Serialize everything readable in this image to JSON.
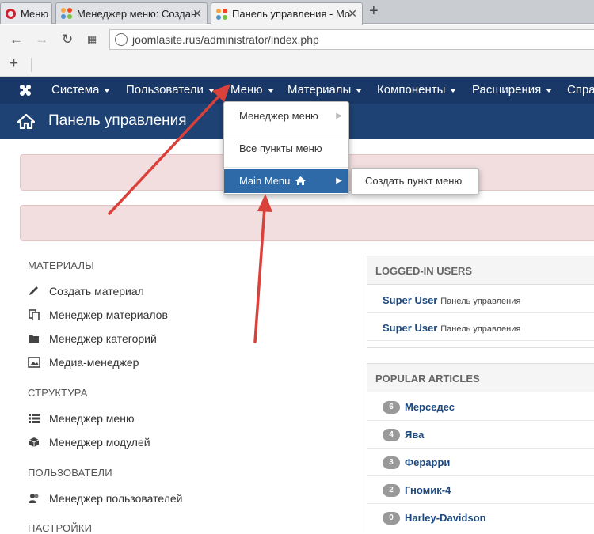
{
  "browser": {
    "tabs": [
      {
        "label": "Меню",
        "type": "opera"
      },
      {
        "label": "Менеджер меню: Создан",
        "type": "joomla"
      },
      {
        "label": "Панель управления - Mo",
        "type": "joomla",
        "active": true
      }
    ],
    "url": "joomlasite.rus/administrator/index.php",
    "new_tab_symbol": "+",
    "bookmark_add_symbol": "+"
  },
  "nav": {
    "items": [
      "Система",
      "Пользователи",
      "Меню",
      "Материалы",
      "Компоненты",
      "Расширения",
      "Спра"
    ]
  },
  "header": {
    "title": "Панель управления"
  },
  "dropdown": {
    "items": [
      "Менеджер меню",
      "Все пункты меню",
      "Main Menu"
    ],
    "submenu_item": "Создать пункт меню"
  },
  "sidebar": {
    "sections": [
      {
        "title": "МАТЕРИАЛЫ",
        "items": [
          "Создать материал",
          "Менеджер материалов",
          "Менеджер категорий",
          "Медиа-менеджер"
        ]
      },
      {
        "title": "СТРУКТУРА",
        "items": [
          "Менеджер меню",
          "Менеджер модулей"
        ]
      },
      {
        "title": "ПОЛЬЗОВАТЕЛИ",
        "items": [
          "Менеджер пользователей"
        ]
      },
      {
        "title": "НАСТРОЙКИ",
        "items": []
      }
    ]
  },
  "logged_in": {
    "title": "LOGGED-IN USERS",
    "rows": [
      {
        "user": "Super User",
        "where": "Панель управления"
      },
      {
        "user": "Super User",
        "where": "Панель управления"
      }
    ]
  },
  "popular": {
    "title": "POPULAR ARTICLES",
    "rows": [
      {
        "hits": "6",
        "title": "Мерседес"
      },
      {
        "hits": "4",
        "title": "Ява"
      },
      {
        "hits": "3",
        "title": "Ферарри"
      },
      {
        "hits": "2",
        "title": "Гномик-4"
      },
      {
        "hits": "0",
        "title": "Harley-Davidson"
      }
    ]
  },
  "colors": {
    "nav_bg": "#1a3867",
    "header_bg": "#1e4273",
    "alert_bg": "#f2dede",
    "arrow": "#d9413a",
    "selected": "#2f6aa8"
  }
}
